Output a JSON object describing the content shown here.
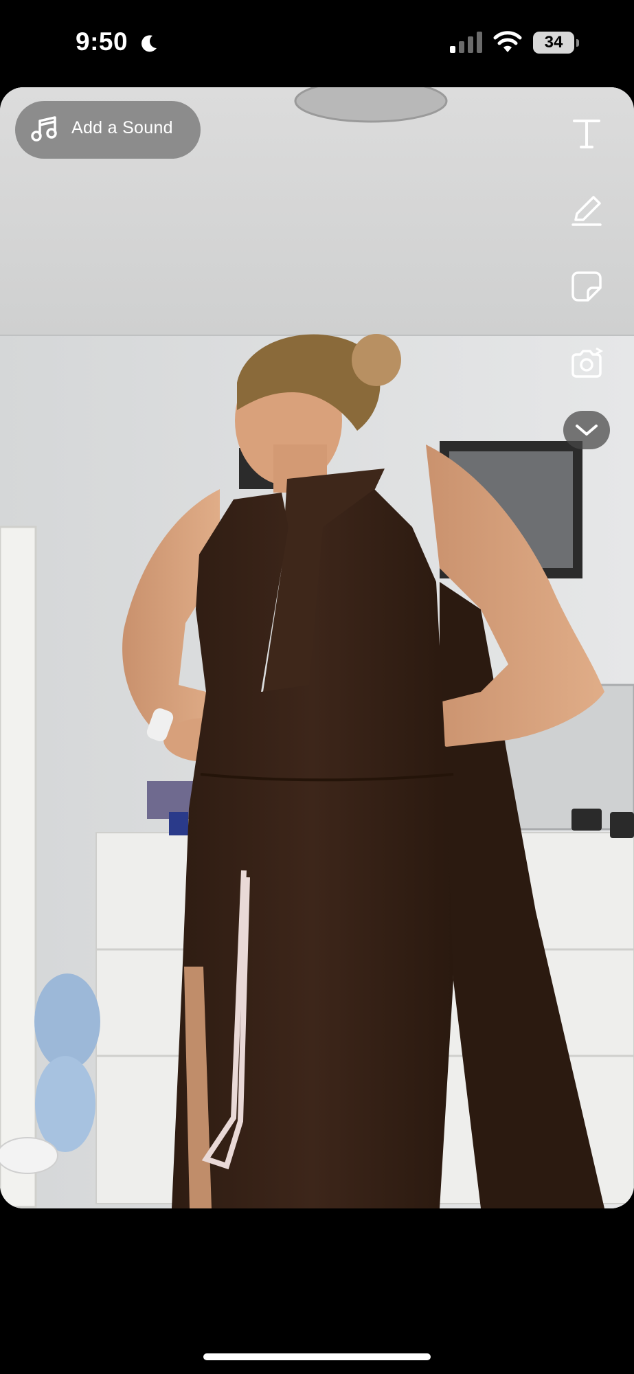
{
  "status_bar": {
    "time": "9:50",
    "focus_icon": "moon-icon",
    "signal_icon": "cellular-signal-icon",
    "wifi_icon": "wifi-icon",
    "battery_level": "34"
  },
  "editor": {
    "sound_button": {
      "icon": "music-note-icon",
      "label": "Add a Sound"
    },
    "tools": [
      {
        "name": "text-tool",
        "icon": "text-icon"
      },
      {
        "name": "draw-tool",
        "icon": "pencil-icon"
      },
      {
        "name": "sticker-tool",
        "icon": "sticker-icon"
      },
      {
        "name": "camera-tool",
        "icon": "camera-flip-icon"
      },
      {
        "name": "more-tools",
        "icon": "chevron-down-icon"
      }
    ]
  },
  "colors": {
    "background": "#000000",
    "wall": "#e3e4e5",
    "dress": "#3a2418",
    "skin": "#d9a27d",
    "pill": "#6e6e6e"
  }
}
